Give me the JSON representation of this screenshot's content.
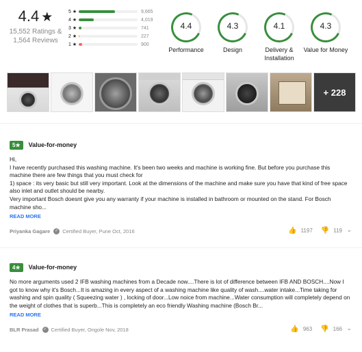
{
  "summary": {
    "average": "4.4",
    "ratings_text": "15,552 Ratings &",
    "reviews_text": "1,564 Reviews",
    "distribution": [
      {
        "label": "5 ★",
        "count": "9,665",
        "fraction": 0.62,
        "color": "#388e3c"
      },
      {
        "label": "4 ★",
        "count": "4,019",
        "fraction": 0.26,
        "color": "#388e3c"
      },
      {
        "label": "3 ★",
        "count": "741",
        "fraction": 0.05,
        "color": "#388e3c"
      },
      {
        "label": "2 ★",
        "count": "227",
        "fraction": 0.015,
        "color": "#ff9f00"
      },
      {
        "label": "1 ★",
        "count": "900",
        "fraction": 0.06,
        "color": "#ff6161"
      }
    ],
    "aspects": [
      {
        "value": "4.4",
        "label": "Performance"
      },
      {
        "value": "4.3",
        "label": "Design"
      },
      {
        "value": "4.1",
        "label": "Delivery &\nInstallation"
      },
      {
        "value": "4.3",
        "label": "Value for Money"
      }
    ]
  },
  "thumbnails": {
    "more_label": "+ 228"
  },
  "reviews": [
    {
      "rating": "5★",
      "title": "Value-for-money",
      "body": "Hi,\nI have recently purchased this washing machine. It's been two weeks and machine is working fine. But before you purchase this machine there are few things that you must check for\n1) space : its very basic but still very important. Look at the dimensions of the machine and make sure you have that kind of free space also inlet and outlet should be nearby.\nVery important Bosch doesnt give you any warranty if your machine is installed in bathroom or mounted on the stand. For Bosch machine sho...",
      "read_more": "READ MORE",
      "author": "Priyanka Gagare",
      "meta": "Certified Buyer, Pune  Oct, 2016",
      "likes": "1197",
      "dislikes": "119"
    },
    {
      "rating": "4★",
      "title": "Value-for-money",
      "body": "No more arguments used 2 IFB washing machines from a Decade now....There is lot of difference between IFB AND BOSCH....Now I got to know why it's Bosch...It is amazing in every aspect of a washing machine like quality of wash....water intake...Time taking for washing and spin quality ( Squeezing water ) , locking of door...Low noice from machine...Water consumption will completely depend on the weight of clothes that is superb...This is completely an eco friendly Washing machine (Bosch Br...",
      "read_more": "READ MORE",
      "author": "BLR Prasad",
      "meta": "Certified Buyer, Ongole  Nov, 2018",
      "likes": "963",
      "dislikes": "166"
    }
  ],
  "colors": {
    "accent_green": "#388e3c",
    "link_blue": "#2874f0"
  }
}
